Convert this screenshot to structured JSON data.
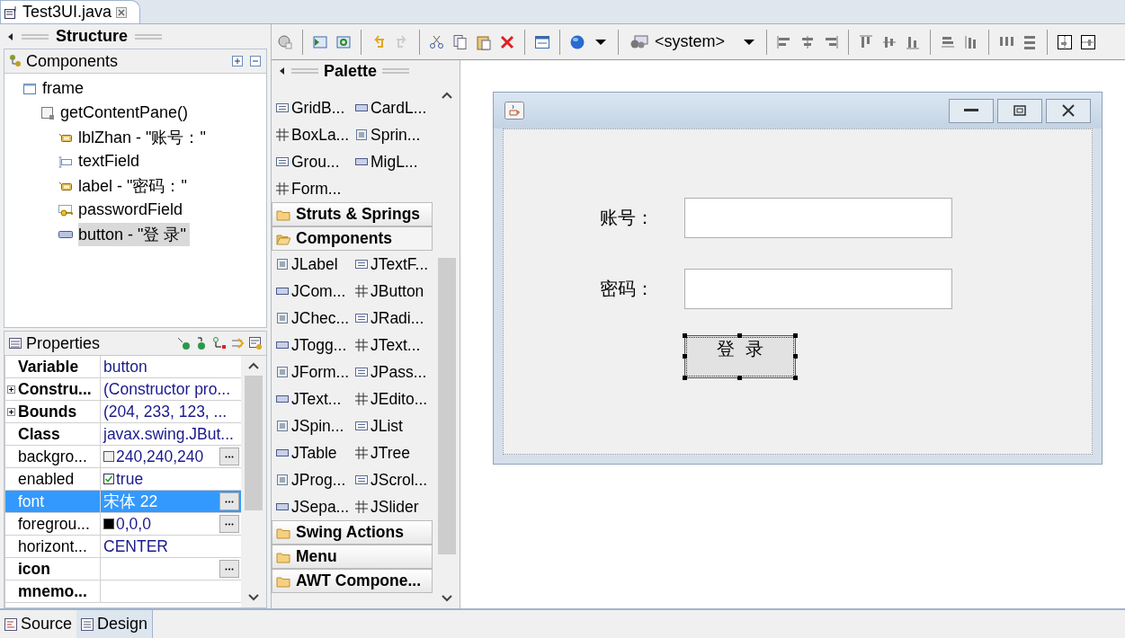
{
  "editor_tab": {
    "title": "Test3UI.java"
  },
  "structure": {
    "title": "Structure"
  },
  "components": {
    "title": "Components",
    "tree": [
      {
        "label": "frame",
        "kind": "frame",
        "selected": false,
        "children": [
          {
            "label": "getContentPane()",
            "kind": "panel",
            "selected": false,
            "children": [
              {
                "label": "lblZhan - \"账号：\"",
                "kind": "label",
                "selected": false
              },
              {
                "label": "textField",
                "kind": "textfield",
                "selected": false
              },
              {
                "label": "label - \"密码：\"",
                "kind": "label",
                "selected": false
              },
              {
                "label": "passwordField",
                "kind": "passwordfield",
                "selected": false
              },
              {
                "label": "button - \"登 录\"",
                "kind": "button",
                "selected": true
              }
            ]
          }
        ]
      }
    ]
  },
  "properties": {
    "title": "Properties",
    "rows": [
      {
        "name": "Variable",
        "value": "button",
        "kind": "text",
        "bold": true,
        "expandable": false,
        "editor": false,
        "selected": false
      },
      {
        "name": "Constru...",
        "value": "(Constructor pro...",
        "kind": "text",
        "bold": true,
        "expandable": true,
        "editor": false,
        "selected": false
      },
      {
        "name": "Bounds",
        "value": "(204, 233, 123, ...",
        "kind": "text",
        "bold": true,
        "expandable": true,
        "editor": false,
        "selected": false
      },
      {
        "name": "Class",
        "value": "javax.swing.JBut...",
        "kind": "text",
        "bold": true,
        "expandable": false,
        "editor": false,
        "selected": false
      },
      {
        "name": "backgro...",
        "value": "240,240,240",
        "kind": "color",
        "color": "#f0f0f0",
        "bold": false,
        "expandable": false,
        "editor": true,
        "selected": false
      },
      {
        "name": "enabled",
        "value": "true",
        "kind": "checkbox",
        "checked": true,
        "bold": false,
        "expandable": false,
        "editor": false,
        "selected": false
      },
      {
        "name": "font",
        "value": "宋体 22",
        "kind": "text",
        "bold": false,
        "expandable": false,
        "editor": true,
        "selected": true
      },
      {
        "name": "foregrou...",
        "value": "0,0,0",
        "kind": "color",
        "color": "#000000",
        "bold": false,
        "expandable": false,
        "editor": true,
        "selected": false
      },
      {
        "name": "horizont...",
        "value": "CENTER",
        "kind": "text",
        "bold": false,
        "expandable": false,
        "editor": false,
        "selected": false
      },
      {
        "name": "icon",
        "value": "",
        "kind": "text",
        "bold": true,
        "expandable": false,
        "editor": true,
        "selected": false
      },
      {
        "name": "mnemo...",
        "value": "",
        "kind": "text",
        "bold": true,
        "expandable": false,
        "editor": false,
        "selected": false
      }
    ]
  },
  "toolbar": {
    "system_dropdown": {
      "value": "<system>"
    }
  },
  "palette": {
    "title": "Palette",
    "sections": [
      {
        "kind": "items",
        "items": [
          "GridB...",
          "CardL...",
          "BoxLa...",
          "Sprin...",
          "Grou...",
          "MigL...",
          "Form..."
        ]
      },
      {
        "kind": "category",
        "label": "Struts & Springs",
        "expanded": false
      },
      {
        "kind": "category",
        "label": "Components",
        "expanded": true
      },
      {
        "kind": "items",
        "items": [
          "JLabel",
          "JTextF...",
          "JCom...",
          "JButton",
          "JChec...",
          "JRadi...",
          "JTogg...",
          "JText...",
          "JForm...",
          "JPass...",
          "JText...",
          "JEdito...",
          "JSpin...",
          "JList",
          "JTable",
          "JTree",
          "JProg...",
          "JScrol...",
          "JSepa...",
          "JSlider"
        ]
      },
      {
        "kind": "category",
        "label": "Swing Actions",
        "expanded": false
      },
      {
        "kind": "category",
        "label": "Menu",
        "expanded": false
      },
      {
        "kind": "category",
        "label": "AWT Compone...",
        "expanded": false
      }
    ]
  },
  "design": {
    "fields": [
      {
        "label": "账号："
      },
      {
        "label": "密码："
      }
    ],
    "button": {
      "label": "登  录",
      "selected": true
    }
  },
  "bottom_tabs": [
    {
      "label": "Source",
      "selected": false
    },
    {
      "label": "Design",
      "selected": true
    }
  ]
}
